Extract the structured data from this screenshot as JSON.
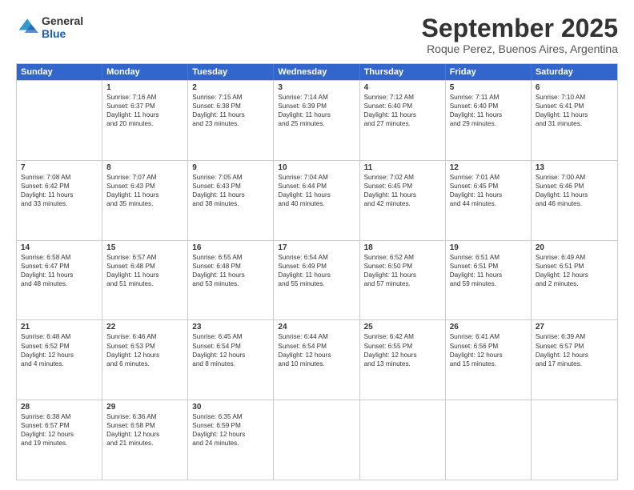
{
  "header": {
    "logo_line1": "General",
    "logo_line2": "Blue",
    "title": "September 2025",
    "subtitle": "Roque Perez, Buenos Aires, Argentina"
  },
  "days": [
    "Sunday",
    "Monday",
    "Tuesday",
    "Wednesday",
    "Thursday",
    "Friday",
    "Saturday"
  ],
  "rows": [
    [
      {
        "num": "",
        "lines": []
      },
      {
        "num": "1",
        "lines": [
          "Sunrise: 7:16 AM",
          "Sunset: 6:37 PM",
          "Daylight: 11 hours",
          "and 20 minutes."
        ]
      },
      {
        "num": "2",
        "lines": [
          "Sunrise: 7:15 AM",
          "Sunset: 6:38 PM",
          "Daylight: 11 hours",
          "and 23 minutes."
        ]
      },
      {
        "num": "3",
        "lines": [
          "Sunrise: 7:14 AM",
          "Sunset: 6:39 PM",
          "Daylight: 11 hours",
          "and 25 minutes."
        ]
      },
      {
        "num": "4",
        "lines": [
          "Sunrise: 7:12 AM",
          "Sunset: 6:40 PM",
          "Daylight: 11 hours",
          "and 27 minutes."
        ]
      },
      {
        "num": "5",
        "lines": [
          "Sunrise: 7:11 AM",
          "Sunset: 6:40 PM",
          "Daylight: 11 hours",
          "and 29 minutes."
        ]
      },
      {
        "num": "6",
        "lines": [
          "Sunrise: 7:10 AM",
          "Sunset: 6:41 PM",
          "Daylight: 11 hours",
          "and 31 minutes."
        ]
      }
    ],
    [
      {
        "num": "7",
        "lines": [
          "Sunrise: 7:08 AM",
          "Sunset: 6:42 PM",
          "Daylight: 11 hours",
          "and 33 minutes."
        ]
      },
      {
        "num": "8",
        "lines": [
          "Sunrise: 7:07 AM",
          "Sunset: 6:43 PM",
          "Daylight: 11 hours",
          "and 35 minutes."
        ]
      },
      {
        "num": "9",
        "lines": [
          "Sunrise: 7:05 AM",
          "Sunset: 6:43 PM",
          "Daylight: 11 hours",
          "and 38 minutes."
        ]
      },
      {
        "num": "10",
        "lines": [
          "Sunrise: 7:04 AM",
          "Sunset: 6:44 PM",
          "Daylight: 11 hours",
          "and 40 minutes."
        ]
      },
      {
        "num": "11",
        "lines": [
          "Sunrise: 7:02 AM",
          "Sunset: 6:45 PM",
          "Daylight: 11 hours",
          "and 42 minutes."
        ]
      },
      {
        "num": "12",
        "lines": [
          "Sunrise: 7:01 AM",
          "Sunset: 6:45 PM",
          "Daylight: 11 hours",
          "and 44 minutes."
        ]
      },
      {
        "num": "13",
        "lines": [
          "Sunrise: 7:00 AM",
          "Sunset: 6:46 PM",
          "Daylight: 11 hours",
          "and 46 minutes."
        ]
      }
    ],
    [
      {
        "num": "14",
        "lines": [
          "Sunrise: 6:58 AM",
          "Sunset: 6:47 PM",
          "Daylight: 11 hours",
          "and 48 minutes."
        ]
      },
      {
        "num": "15",
        "lines": [
          "Sunrise: 6:57 AM",
          "Sunset: 6:48 PM",
          "Daylight: 11 hours",
          "and 51 minutes."
        ]
      },
      {
        "num": "16",
        "lines": [
          "Sunrise: 6:55 AM",
          "Sunset: 6:48 PM",
          "Daylight: 11 hours",
          "and 53 minutes."
        ]
      },
      {
        "num": "17",
        "lines": [
          "Sunrise: 6:54 AM",
          "Sunset: 6:49 PM",
          "Daylight: 11 hours",
          "and 55 minutes."
        ]
      },
      {
        "num": "18",
        "lines": [
          "Sunrise: 6:52 AM",
          "Sunset: 6:50 PM",
          "Daylight: 11 hours",
          "and 57 minutes."
        ]
      },
      {
        "num": "19",
        "lines": [
          "Sunrise: 6:51 AM",
          "Sunset: 6:51 PM",
          "Daylight: 11 hours",
          "and 59 minutes."
        ]
      },
      {
        "num": "20",
        "lines": [
          "Sunrise: 6:49 AM",
          "Sunset: 6:51 PM",
          "Daylight: 12 hours",
          "and 2 minutes."
        ]
      }
    ],
    [
      {
        "num": "21",
        "lines": [
          "Sunrise: 6:48 AM",
          "Sunset: 6:52 PM",
          "Daylight: 12 hours",
          "and 4 minutes."
        ]
      },
      {
        "num": "22",
        "lines": [
          "Sunrise: 6:46 AM",
          "Sunset: 6:53 PM",
          "Daylight: 12 hours",
          "and 6 minutes."
        ]
      },
      {
        "num": "23",
        "lines": [
          "Sunrise: 6:45 AM",
          "Sunset: 6:54 PM",
          "Daylight: 12 hours",
          "and 8 minutes."
        ]
      },
      {
        "num": "24",
        "lines": [
          "Sunrise: 6:44 AM",
          "Sunset: 6:54 PM",
          "Daylight: 12 hours",
          "and 10 minutes."
        ]
      },
      {
        "num": "25",
        "lines": [
          "Sunrise: 6:42 AM",
          "Sunset: 6:55 PM",
          "Daylight: 12 hours",
          "and 13 minutes."
        ]
      },
      {
        "num": "26",
        "lines": [
          "Sunrise: 6:41 AM",
          "Sunset: 6:56 PM",
          "Daylight: 12 hours",
          "and 15 minutes."
        ]
      },
      {
        "num": "27",
        "lines": [
          "Sunrise: 6:39 AM",
          "Sunset: 6:57 PM",
          "Daylight: 12 hours",
          "and 17 minutes."
        ]
      }
    ],
    [
      {
        "num": "28",
        "lines": [
          "Sunrise: 6:38 AM",
          "Sunset: 6:57 PM",
          "Daylight: 12 hours",
          "and 19 minutes."
        ]
      },
      {
        "num": "29",
        "lines": [
          "Sunrise: 6:36 AM",
          "Sunset: 6:58 PM",
          "Daylight: 12 hours",
          "and 21 minutes."
        ]
      },
      {
        "num": "30",
        "lines": [
          "Sunrise: 6:35 AM",
          "Sunset: 6:59 PM",
          "Daylight: 12 hours",
          "and 24 minutes."
        ]
      },
      {
        "num": "",
        "lines": []
      },
      {
        "num": "",
        "lines": []
      },
      {
        "num": "",
        "lines": []
      },
      {
        "num": "",
        "lines": []
      }
    ]
  ]
}
